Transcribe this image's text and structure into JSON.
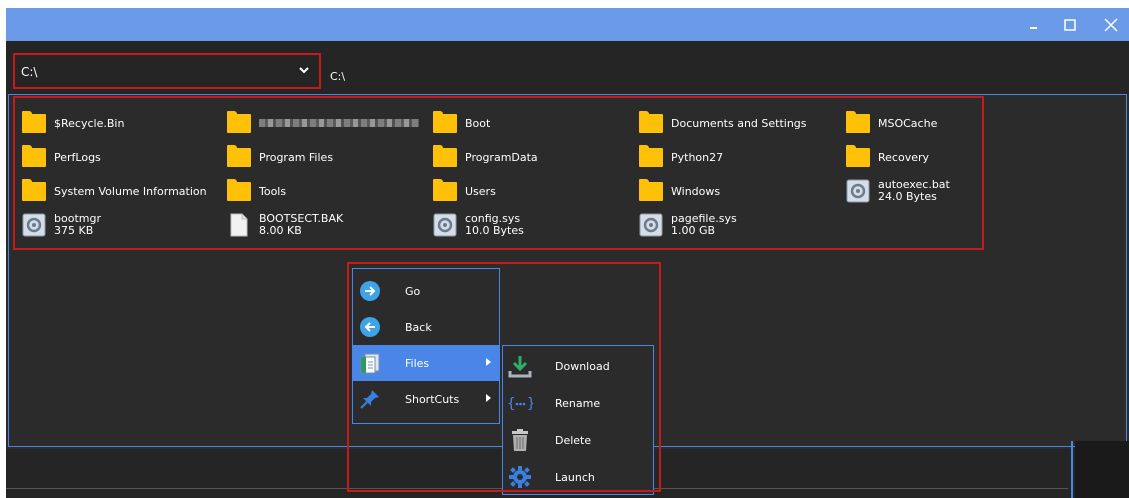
{
  "window": {
    "titlebar_color": "#6a9ae8",
    "controls": {
      "minimize": "minimize-icon",
      "maximize": "maximize-icon",
      "close": "close-icon"
    }
  },
  "pathbar": {
    "selected_path": "C:\\",
    "current_path": "C:\\",
    "caret_icon": "chevron-down-icon"
  },
  "files": [
    {
      "name": "$Recycle.Bin",
      "icon": "folder-icon",
      "size": ""
    },
    {
      "name": "",
      "icon": "folder-icon",
      "size": "",
      "blurred": true
    },
    {
      "name": "Boot",
      "icon": "folder-icon",
      "size": ""
    },
    {
      "name": "Documents and Settings",
      "icon": "folder-icon",
      "size": ""
    },
    {
      "name": "MSOCache",
      "icon": "folder-icon",
      "size": ""
    },
    {
      "name": "PerfLogs",
      "icon": "folder-icon",
      "size": ""
    },
    {
      "name": "Program Files",
      "icon": "folder-icon",
      "size": ""
    },
    {
      "name": "ProgramData",
      "icon": "folder-icon",
      "size": ""
    },
    {
      "name": "Python27",
      "icon": "folder-icon",
      "size": ""
    },
    {
      "name": "Recovery",
      "icon": "folder-icon",
      "size": ""
    },
    {
      "name": "System Volume Information",
      "icon": "folder-icon",
      "size": ""
    },
    {
      "name": "Tools",
      "icon": "folder-icon",
      "size": ""
    },
    {
      "name": "Users",
      "icon": "folder-icon",
      "size": ""
    },
    {
      "name": "Windows",
      "icon": "folder-icon",
      "size": ""
    },
    {
      "name": "autoexec.bat",
      "icon": "system-file-icon",
      "size": "24.0 Bytes"
    },
    {
      "name": "bootmgr",
      "icon": "system-file-icon",
      "size": "375 KB"
    },
    {
      "name": "BOOTSECT.BAK",
      "icon": "document-icon",
      "size": "8.00 KB"
    },
    {
      "name": "config.sys",
      "icon": "system-file-icon",
      "size": "10.0 Bytes"
    },
    {
      "name": "pagefile.sys",
      "icon": "system-file-icon",
      "size": "1.00 GB"
    }
  ],
  "context_menu": {
    "items": [
      {
        "label": "Go",
        "icon": "arrow-right-circle-icon",
        "has_submenu": false
      },
      {
        "label": "Back",
        "icon": "arrow-left-circle-icon",
        "has_submenu": false
      },
      {
        "label": "Files",
        "icon": "files-icon",
        "has_submenu": true,
        "active": true
      },
      {
        "label": "ShortCuts",
        "icon": "pin-icon",
        "has_submenu": true
      }
    ],
    "submenu": [
      {
        "label": "Download",
        "icon": "download-icon"
      },
      {
        "label": "Rename",
        "icon": "rename-icon"
      },
      {
        "label": "Delete",
        "icon": "trash-icon"
      },
      {
        "label": "Launch",
        "icon": "gear-icon"
      }
    ]
  },
  "colors": {
    "accent": "#4a86e8",
    "highlight_outline": "#c51b1b",
    "background": "#2b2b2b",
    "folder": "#ffc107"
  }
}
